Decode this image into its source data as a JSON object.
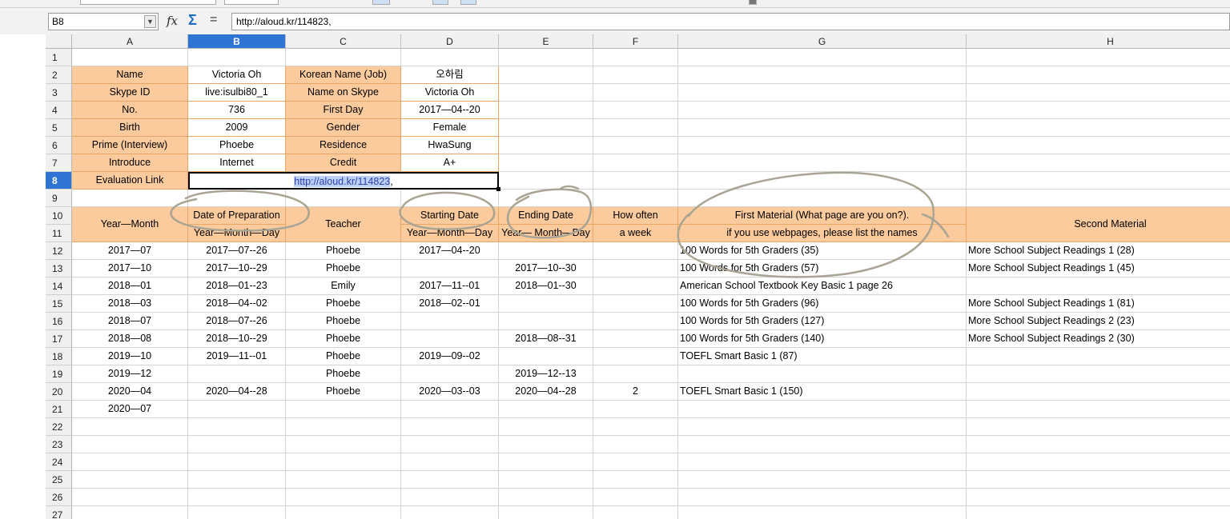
{
  "formula_bar": {
    "cell_ref": "B8",
    "fx_label": "fx",
    "sum_label": "Σ",
    "equals_label": "=",
    "content": "http://aloud.kr/114823,"
  },
  "columns": [
    "A",
    "B",
    "C",
    "D",
    "E",
    "F",
    "G",
    "H"
  ],
  "active_column": "B",
  "rows": [
    "1",
    "2",
    "3",
    "4",
    "5",
    "6",
    "7",
    "8",
    "9",
    "10",
    "11",
    "12",
    "13",
    "14",
    "15",
    "16",
    "17",
    "18",
    "19",
    "20",
    "21",
    "22",
    "23",
    "24",
    "25",
    "26",
    "27"
  ],
  "active_row": "8",
  "profile": {
    "name_label": "Name",
    "name_value": "Victoria Oh",
    "korean_name_label": "Korean Name (Job)",
    "korean_name_value": "오하림",
    "skype_id_label": "Skype ID",
    "skype_id_value": "live:isulbi80_1",
    "name_on_skype_label": "Name on Skype",
    "name_on_skype_value": "Victoria Oh",
    "no_label": "No.",
    "no_value": "736",
    "first_day_label": "First Day",
    "first_day_value": "2017—04--20",
    "birth_label": "Birth",
    "birth_value": "2009",
    "gender_label": "Gender",
    "gender_value": "Female",
    "prime_label": "Prime (Interview)",
    "prime_value": "Phoebe",
    "residence_label": "Residence",
    "residence_value": "HwaSung",
    "introduce_label": "Introduce",
    "introduce_value": "Internet",
    "credit_label": "Credit",
    "credit_value": "A+",
    "eval_label": "Evaluation Link",
    "eval_link": "http://aloud.kr/114823",
    "eval_suffix": ","
  },
  "table_header": {
    "year_month": "Year—Month",
    "date_prep": "Date of Preparation",
    "date_prep_sub": "Year—Month—Day",
    "teacher": "Teacher",
    "starting_date": "Starting Date",
    "starting_date_sub": "Year—Month—Day",
    "ending_date": "Ending Date",
    "ending_date_sub": "Year— Month—Day",
    "how_often": "How often",
    "how_often_sub": "a week",
    "first_material": "First Material (What page are you on?).",
    "first_material_sub": "if you use webpages, please list the names",
    "second_material": "Second Material"
  },
  "records": [
    {
      "ym": "2017—07",
      "prep": "2017—07--26",
      "teacher": "Phoebe",
      "start": "2017—04--20",
      "end": "",
      "often": "",
      "first": "100 Words for 5th Graders (35)",
      "second": "More School Subject Readings 1 (28)"
    },
    {
      "ym": "2017—10",
      "prep": "2017—10--29",
      "teacher": "Phoebe",
      "start": "",
      "end": "2017—10--30",
      "often": "",
      "first": "100 Words for 5th Graders (57)",
      "second": "More School Subject Readings 1 (45)"
    },
    {
      "ym": "2018—01",
      "prep": "2018—01--23",
      "teacher": "Emily",
      "start": "2017—11--01",
      "end": "2018—01--30",
      "often": "",
      "first": "American School Textbook Key Basic 1 page 26",
      "second": ""
    },
    {
      "ym": "2018—03",
      "prep": "2018—04--02",
      "teacher": "Phoebe",
      "start": "2018—02--01",
      "end": "",
      "often": "",
      "first": "100 Words for 5th Graders (96)",
      "second": "More School Subject Readings 1 (81)"
    },
    {
      "ym": "2018—07",
      "prep": "2018—07--26",
      "teacher": "Phoebe",
      "start": "",
      "end": "",
      "often": "",
      "first": "100 Words for 5th Graders (127)",
      "second": "More School Subject Readings 2 (23)"
    },
    {
      "ym": "2018—08",
      "prep": "2018—10--29",
      "teacher": "Phoebe",
      "start": "",
      "end": "2018—08--31",
      "often": "",
      "first": "100 Words for 5th Graders (140)",
      "second": "More School Subject Readings 2 (30)"
    },
    {
      "ym": "2019—10",
      "prep": "2019—11--01",
      "teacher": "Phoebe",
      "start": "2019—09--02",
      "end": "",
      "often": "",
      "first": "TOEFL Smart Basic 1 (87)",
      "second": ""
    },
    {
      "ym": "2019—12",
      "prep": "",
      "teacher": "Phoebe",
      "start": "",
      "end": "2019—12--13",
      "often": "",
      "first": "",
      "second": ""
    },
    {
      "ym": "2020—04",
      "prep": "2020—04--28",
      "teacher": "Phoebe",
      "start": "2020—03--03",
      "end": "2020—04--28",
      "often": "2",
      "first": "TOEFL Smart Basic 1 (150)",
      "second": ""
    },
    {
      "ym": "2020—07",
      "prep": "",
      "teacher": "",
      "start": "",
      "end": "",
      "often": "",
      "first": "",
      "second": ""
    }
  ],
  "colors": {
    "header_fill": "#fbcb9d",
    "selection_blue": "#2e75d3",
    "annotation_pen": "#a9a493"
  }
}
